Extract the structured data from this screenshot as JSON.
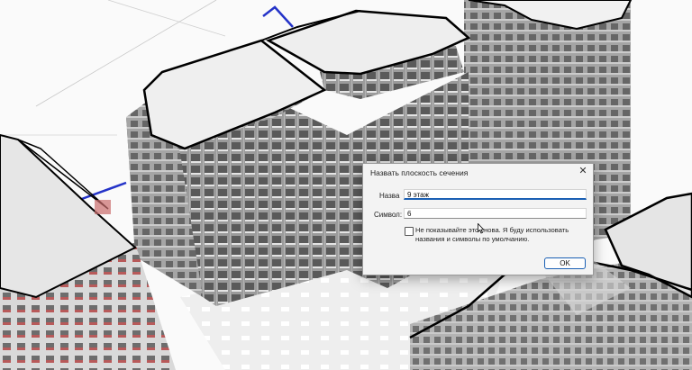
{
  "dialog": {
    "title": "Назвать плоскость сечения",
    "close_glyph": "✕",
    "name_label": "Назва",
    "name_value": "9 этаж",
    "symbol_label": "Символ:",
    "symbol_value": "6",
    "checkbox_checked": false,
    "checkbox_label": "Не показывайте это снова. Я буду использовать названия и символы по умолчанию.",
    "ok_label": "OK"
  },
  "scene": {
    "icons": [
      "mouse-cursor-icon",
      "close-icon"
    ],
    "colors": {
      "facade": "#8a8a8a",
      "roof": "#ececec",
      "outline": "#000000",
      "accent_line": "#2433c8",
      "balcony_red": "#b85a5a"
    }
  }
}
